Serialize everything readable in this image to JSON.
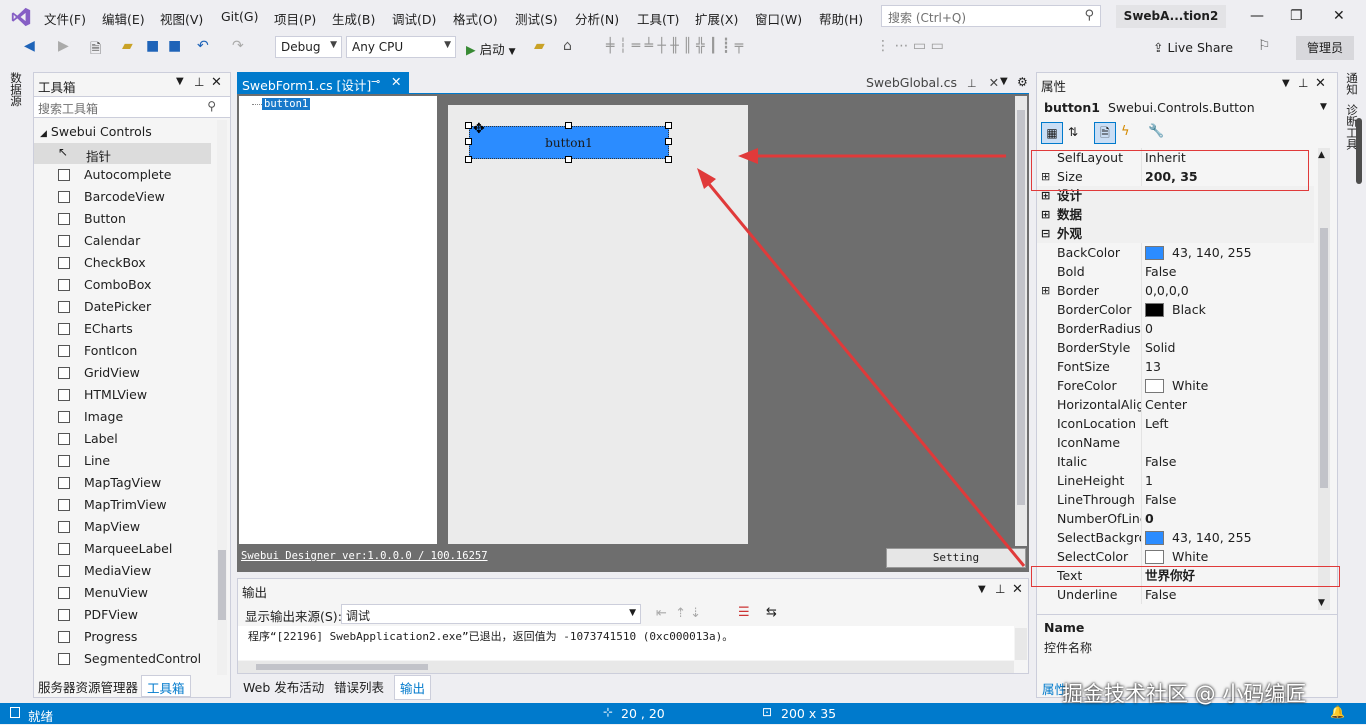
{
  "menu": [
    "文件(F)",
    "编辑(E)",
    "视图(V)",
    "Git(G)",
    "项目(P)",
    "生成(B)",
    "调试(D)",
    "格式(O)",
    "测试(S)",
    "分析(N)",
    "工具(T)",
    "扩展(X)",
    "窗口(W)",
    "帮助(H)"
  ],
  "search": {
    "placeholder": "搜索 (Ctrl+Q)"
  },
  "solution_title": "SwebA...tion2",
  "toolbar": {
    "config": "Debug",
    "platform": "Any CPU",
    "start": "启动",
    "live_share": "Live Share",
    "admin": "管理员"
  },
  "left_vertical_tabs": [
    "数据源"
  ],
  "right_vertical_tabs": [
    "通知",
    "诊断工具"
  ],
  "toolbox": {
    "title": "工具箱",
    "search_placeholder": "搜索工具箱",
    "group": "Swebui Controls",
    "pointer": "指针",
    "items": [
      "Autocomplete",
      "BarcodeView",
      "Button",
      "Calendar",
      "CheckBox",
      "ComboBox",
      "DatePicker",
      "ECharts",
      "FontIcon",
      "GridView",
      "HTMLView",
      "Image",
      "Label",
      "Line",
      "MapTagView",
      "MapTrimView",
      "MapView",
      "MarqueeLabel",
      "MediaView",
      "MenuView",
      "PDFView",
      "Progress",
      "SegmentedControl"
    ]
  },
  "toolbox_bottom_tabs": [
    "服务器资源管理器",
    "工具箱"
  ],
  "doc_tabs": {
    "active": "SwebForm1.cs [设计]",
    "other": "SwebGlobal.cs"
  },
  "designer": {
    "tree_node": "button1",
    "button_text": "button1",
    "version": "Swebui Designer ver:1.0.0.0 / 100.16257",
    "setting": "Setting"
  },
  "output": {
    "title": "输出",
    "source_label": "显示输出来源(S):",
    "source_value": "调试",
    "line": "程序“[22196] SwebApplication2.exe”已退出，返回值为 -1073741510 (0xc000013a)。"
  },
  "output_bottom_tabs": [
    "Web 发布活动",
    "错误列表",
    "输出"
  ],
  "properties": {
    "title": "属性",
    "object": "button1",
    "object_type": "Swebui.Controls.Button",
    "rows": [
      {
        "name": "SelfLayout",
        "value": "Inherit"
      },
      {
        "name": "Size",
        "value": "200, 35",
        "bold": true,
        "expand": "+"
      },
      {
        "name": "设计",
        "cat": true,
        "expand": "+"
      },
      {
        "name": "数据",
        "cat": true,
        "expand": "+"
      },
      {
        "name": "外观",
        "cat": true,
        "expand": "−"
      },
      {
        "name": "BackColor",
        "value": "43, 140, 255",
        "color": "#2b8cff"
      },
      {
        "name": "Bold",
        "value": "False"
      },
      {
        "name": "Border",
        "value": "0,0,0,0",
        "expand": "+"
      },
      {
        "name": "BorderColor",
        "value": "Black",
        "color": "#000000"
      },
      {
        "name": "BorderRadius",
        "value": "0"
      },
      {
        "name": "BorderStyle",
        "value": "Solid"
      },
      {
        "name": "FontSize",
        "value": "13"
      },
      {
        "name": "ForeColor",
        "value": "White",
        "color": "#ffffff"
      },
      {
        "name": "HorizontalAlig",
        "value": "Center"
      },
      {
        "name": "IconLocation",
        "value": "Left"
      },
      {
        "name": "IconName",
        "value": ""
      },
      {
        "name": "Italic",
        "value": "False"
      },
      {
        "name": "LineHeight",
        "value": "1"
      },
      {
        "name": "LineThrough",
        "value": "False"
      },
      {
        "name": "NumberOfLine",
        "value": "0",
        "bold": true
      },
      {
        "name": "SelectBackgro",
        "value": "43, 140, 255",
        "color": "#2b8cff"
      },
      {
        "name": "SelectColor",
        "value": "White",
        "color": "#ffffff"
      },
      {
        "name": "Text",
        "value": "世界你好",
        "bold": true
      },
      {
        "name": "Underline",
        "value": "False"
      }
    ],
    "desc_title": "Name",
    "desc_text": "控件名称",
    "bottom_tab": "属性"
  },
  "status": {
    "text": "就绪",
    "position": "20 , 20",
    "size": "200 x 35"
  },
  "watermark": "掘金技术社区 @ 小码编匠",
  "colors": {
    "accent": "#007acc",
    "button_back": "#2b8cff",
    "annotation": "#e03a3a"
  }
}
